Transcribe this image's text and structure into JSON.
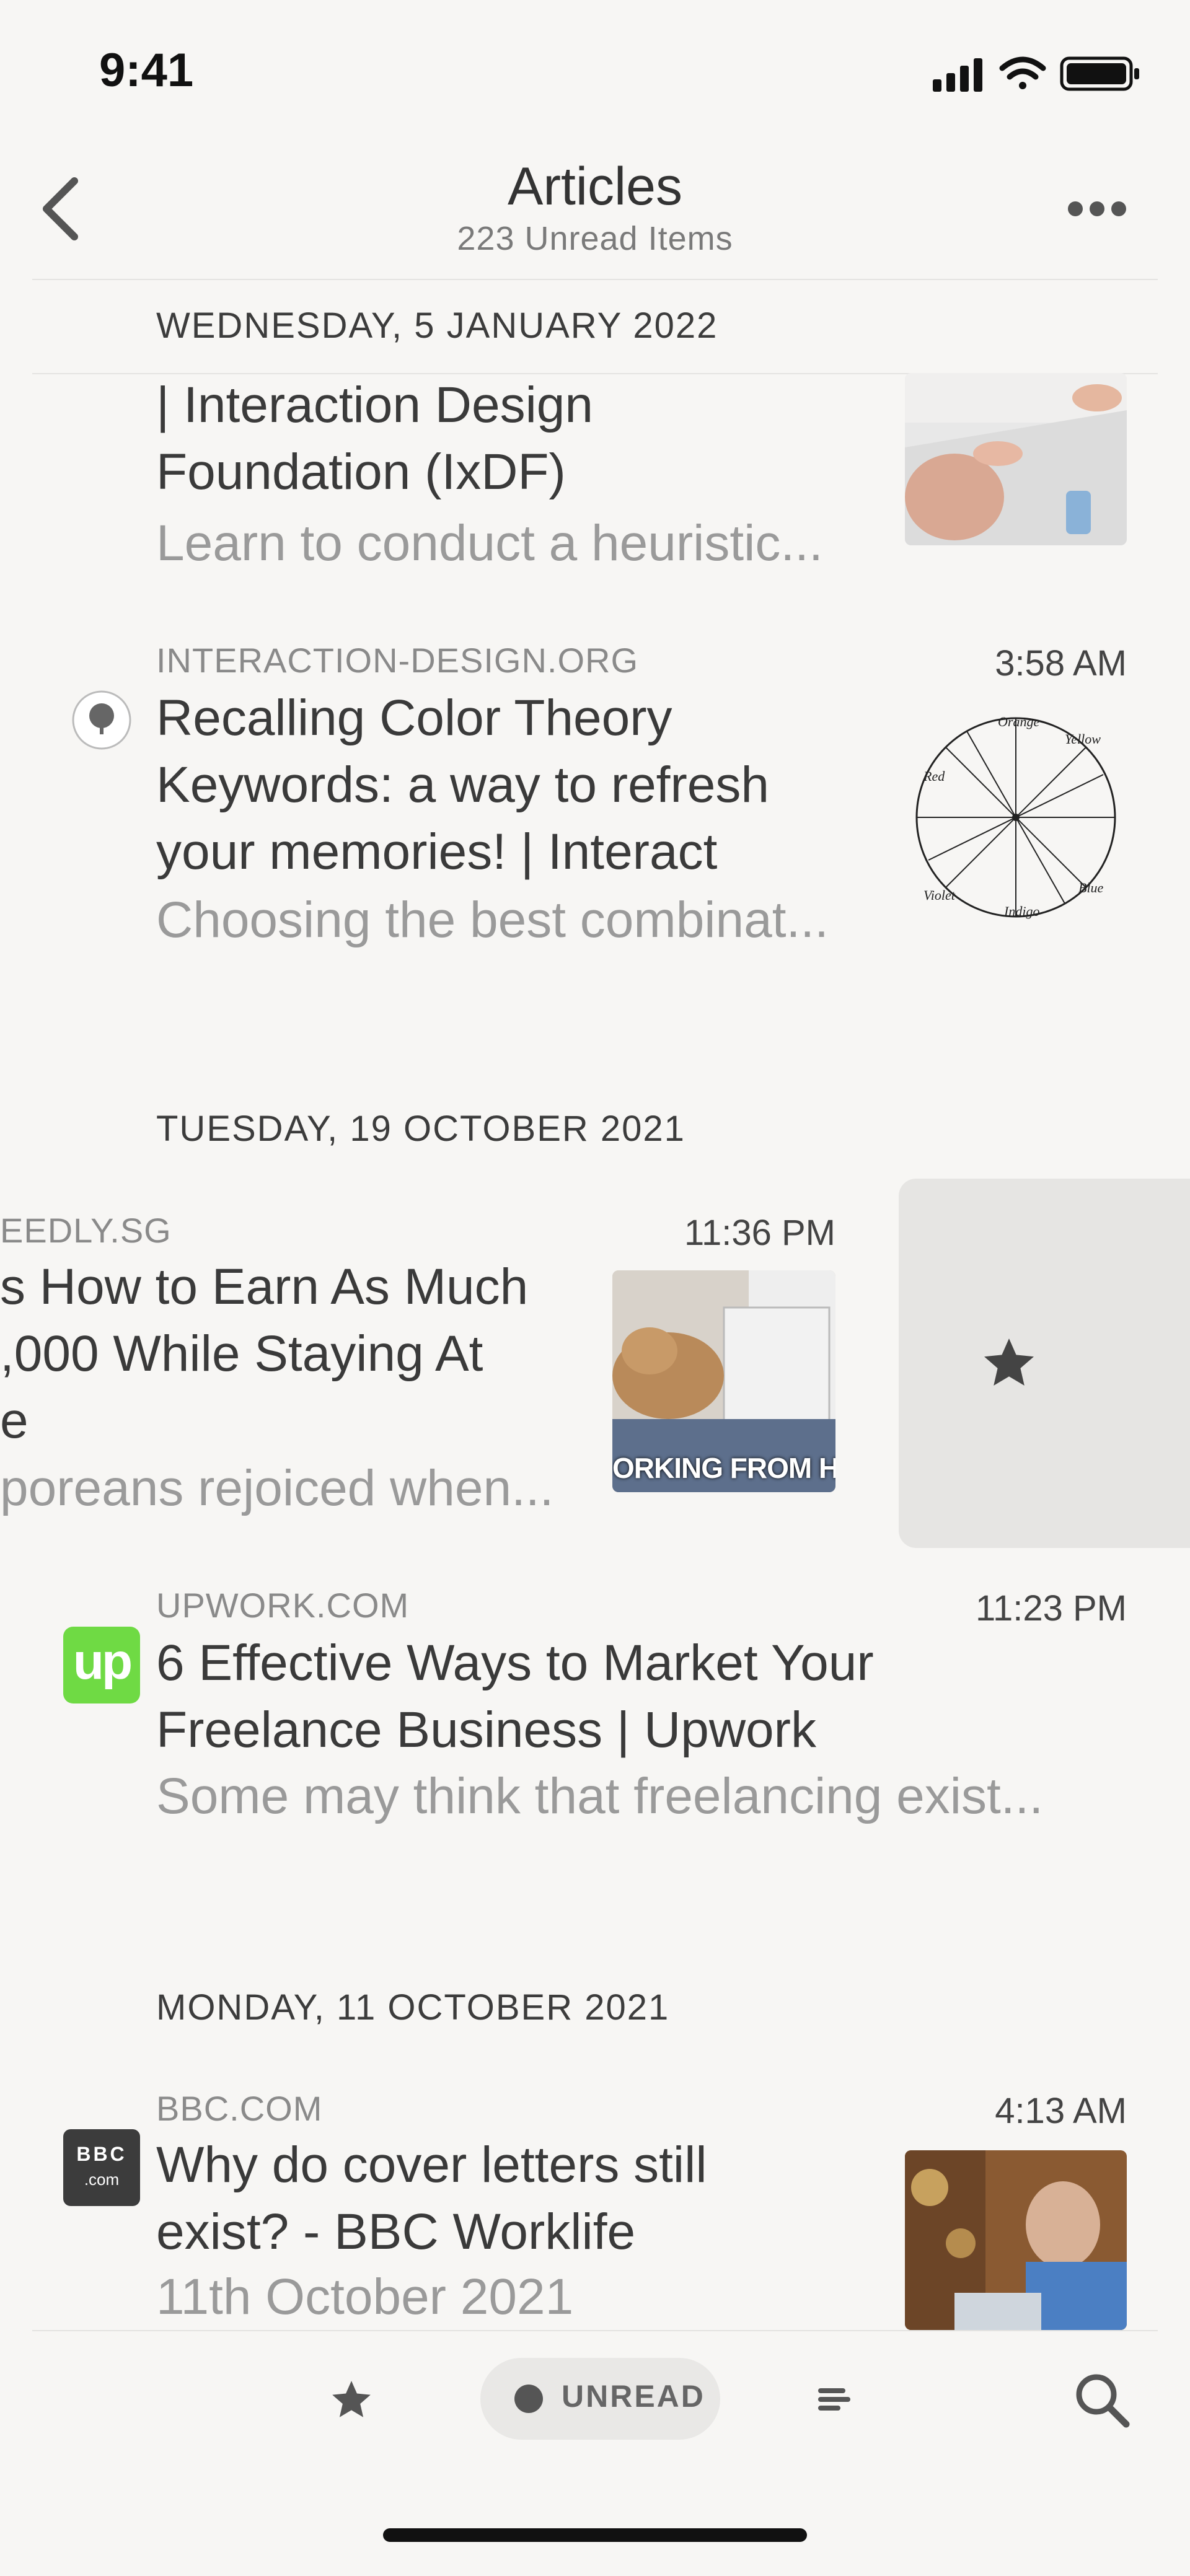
{
  "status_bar": {
    "time": "9:41"
  },
  "header": {
    "title": "Articles",
    "subtitle": "223 Unread Items"
  },
  "sections": [
    {
      "date": "WEDNESDAY, 5 JANUARY 2022",
      "articles": [
        {
          "headline_lines": [
            "| Interaction Design",
            "Foundation (IxDF)"
          ],
          "snippet": "Learn to conduct a heuristic..."
        },
        {
          "source": "INTERACTION-DESIGN.ORG",
          "time": "3:58 AM",
          "headline_lines": [
            "Recalling Color Theory",
            "Keywords: a way to refresh",
            "your memories! | Interact"
          ],
          "snippet": "Choosing the best combinat...",
          "thumb_labels": [
            "Orange",
            "Yellow",
            "Red",
            "Blue",
            "Indigo",
            "Violet"
          ]
        }
      ]
    },
    {
      "date": "TUESDAY, 19 OCTOBER 2021",
      "articles": [
        {
          "source": "EEDLY.SG",
          "time": "11:36 PM",
          "headline_lines": [
            "s How to Earn As Much",
            ",000 While Staying At",
            "e"
          ],
          "snippet": "poreans rejoiced when...",
          "thumb_caption": "ORKING FROM HOI"
        },
        {
          "source": "UPWORK.COM",
          "time": "11:23 PM",
          "headline_lines": [
            "6 Effective Ways to Market Your",
            "Freelance Business | Upwork"
          ],
          "snippet": "Some may think that freelancing exist...",
          "logo_text": "up"
        }
      ]
    },
    {
      "date": "MONDAY, 11 OCTOBER 2021",
      "articles": [
        {
          "source": "BBC.COM",
          "time": "4:13 AM",
          "headline_lines": [
            "Why do cover letters still",
            "exist? - BBC Worklife"
          ],
          "snippet": "11th October 2021",
          "logo_text": "BBC",
          "logo_sub": ".com"
        }
      ]
    }
  ],
  "tab_bar": {
    "unread_label": "UNREAD"
  },
  "colors": {
    "upwork_green": "#6fda44",
    "swipe_bg": "#e6e5e3",
    "background": "#f7f6f4"
  }
}
